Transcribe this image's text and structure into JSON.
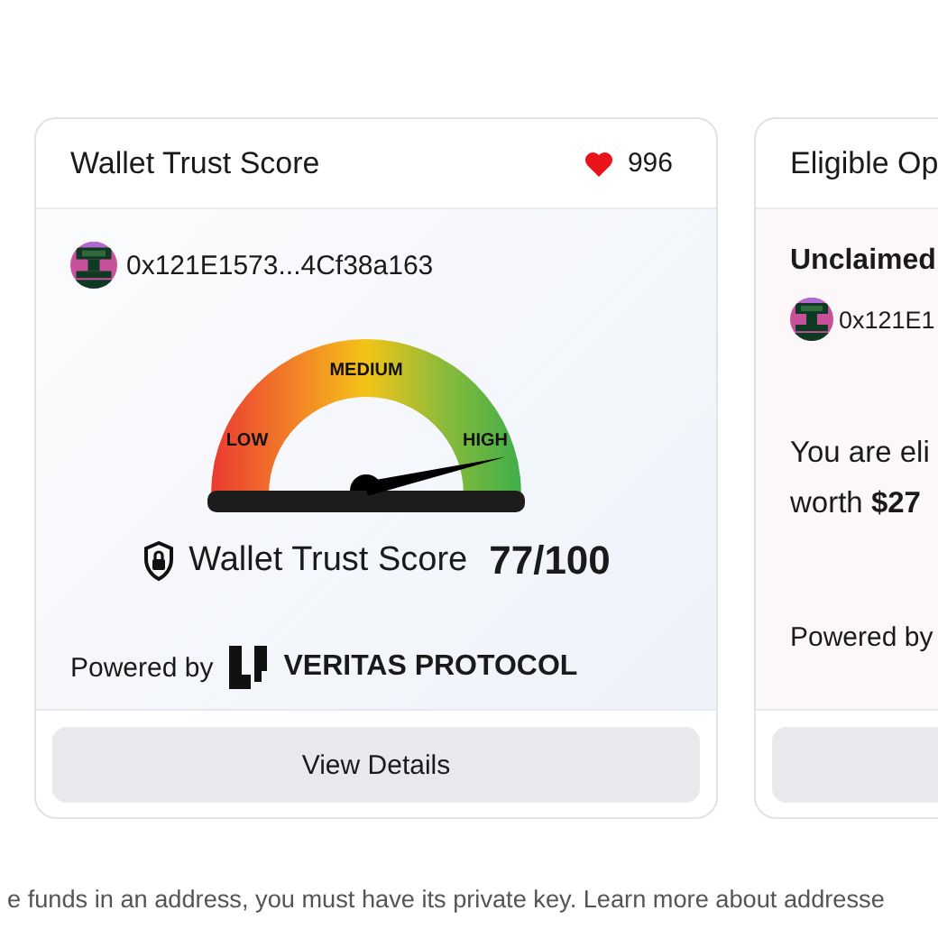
{
  "cards": [
    {
      "kind": "trust",
      "title": "Wallet Trust Score",
      "likes": "996",
      "address": "0x121E1573...4Cf38a163",
      "gauge": {
        "labels": [
          "LOW",
          "MEDIUM",
          "HIGH"
        ]
      },
      "score_label": "Wallet Trust Score",
      "score": "77/100",
      "powered_by": "Powered by",
      "brand": "VERITAS PROTOCOL",
      "button": "View Details"
    },
    {
      "kind": "eligible",
      "title": "Eligible Op",
      "heading": "Unclaimed",
      "address": "0x121E1",
      "message": [
        "You are eli",
        "worth **$27**"
      ],
      "powered_by": "Powered by"
    }
  ],
  "footer_note": "e funds in an address, you must have its private key. Learn more about addresse"
}
